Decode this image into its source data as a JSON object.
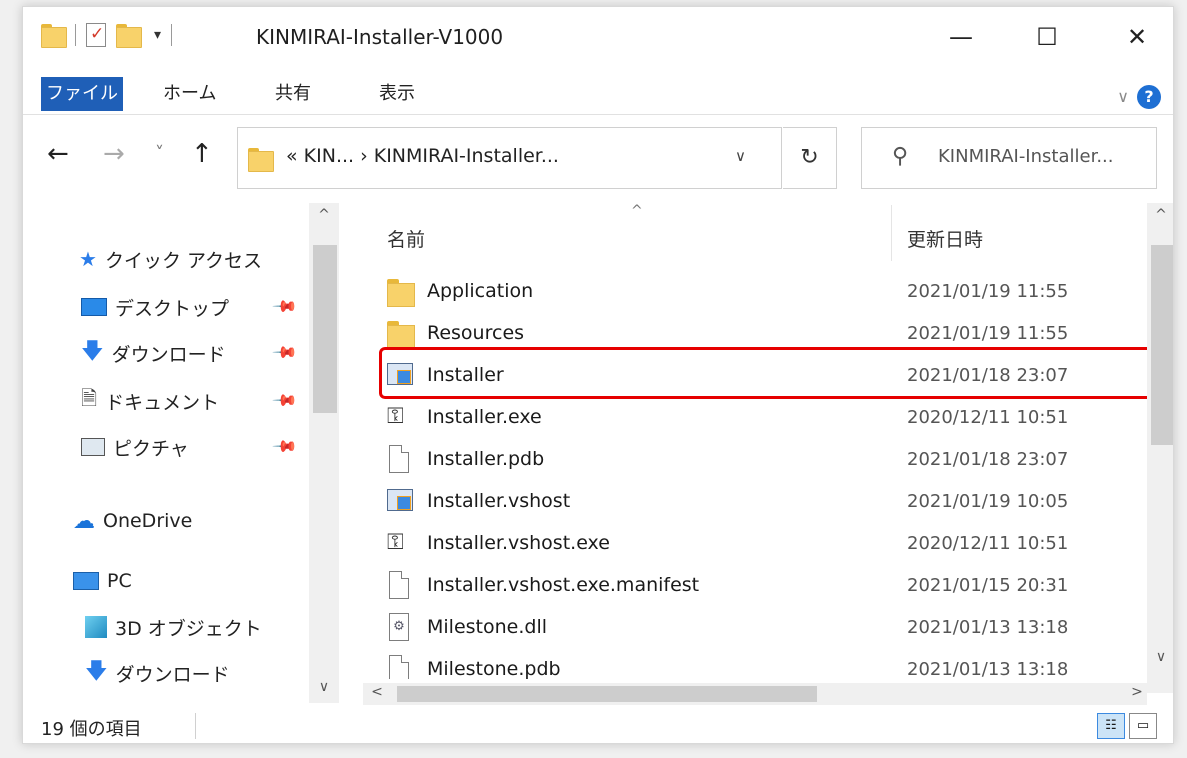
{
  "window": {
    "title": "KINMIRAI-Installer-V1000",
    "qat_down": "▾",
    "minimize_glyph": "—",
    "maximize_glyph": "☐",
    "close_glyph": "✕"
  },
  "ribbon": {
    "tabs": [
      "ファイル",
      "ホーム",
      "共有",
      "表示"
    ],
    "collapse_glyph": "∨",
    "help_glyph": "?"
  },
  "nav": {
    "back_glyph": "←",
    "forward_glyph": "→",
    "recent_glyph": "˅",
    "up_glyph": "↑",
    "address_text": "«   KIN...   ›   KINMIRAI-Installer...",
    "address_drop_glyph": "∨",
    "refresh_glyph": "↻",
    "search_placeholder": "KINMIRAI-Installer...",
    "search_icon_glyph": "⚲"
  },
  "sidebar": {
    "items": [
      {
        "label": "クイック アクセス",
        "icon": "star-icon",
        "glyph": "★",
        "pinned": false
      },
      {
        "label": "デスクトップ",
        "icon": "desktop-icon",
        "glyph": "",
        "pinned": true
      },
      {
        "label": "ダウンロード",
        "icon": "download-icon",
        "glyph": "🡇",
        "pinned": true
      },
      {
        "label": "ドキュメント",
        "icon": "document-icon",
        "glyph": "🗎",
        "pinned": true
      },
      {
        "label": "ピクチャ",
        "icon": "picture-icon",
        "glyph": "",
        "pinned": true
      },
      {
        "label": "OneDrive",
        "icon": "cloud-icon",
        "glyph": "☁",
        "pinned": false
      },
      {
        "label": "PC",
        "icon": "pc-icon",
        "glyph": "",
        "pinned": false
      },
      {
        "label": "3D オブジェクト",
        "icon": "cube-icon",
        "glyph": "",
        "pinned": false
      },
      {
        "label": "ダウンロード",
        "icon": "download-icon",
        "glyph": "🡇",
        "pinned": false
      }
    ],
    "pin_glyph": "📌"
  },
  "filelist": {
    "columns": {
      "name": "名前",
      "date": "更新日時"
    },
    "sort_glyph": "^",
    "rows": [
      {
        "name": "Application",
        "date": "2021/01/19 11:55",
        "type": "folder"
      },
      {
        "name": "Resources",
        "date": "2021/01/19 11:55",
        "type": "folder"
      },
      {
        "name": "Installer",
        "date": "2021/01/18 23:07",
        "type": "config"
      },
      {
        "name": "Installer.exe",
        "date": "2020/12/11 10:51",
        "type": "exe"
      },
      {
        "name": "Installer.pdb",
        "date": "2021/01/18 23:07",
        "type": "file"
      },
      {
        "name": "Installer.vshost",
        "date": "2021/01/19 10:05",
        "type": "config"
      },
      {
        "name": "Installer.vshost.exe",
        "date": "2020/12/11 10:51",
        "type": "exe"
      },
      {
        "name": "Installer.vshost.exe.manifest",
        "date": "2021/01/15 20:31",
        "type": "file"
      },
      {
        "name": "Milestone.dll",
        "date": "2021/01/13 13:18",
        "type": "dll"
      },
      {
        "name": "Milestone.pdb",
        "date": "2021/01/13 13:18",
        "type": "file"
      }
    ],
    "highlighted_row": "Installer",
    "highlight_color": "#e60000"
  },
  "scroll": {
    "up": "^",
    "down": "∨",
    "left": "<",
    "right": ">"
  },
  "status": {
    "item_count": "19 個の項目"
  },
  "colors": {
    "accent": "#1f5fb7",
    "folder": "#f8d26a"
  }
}
